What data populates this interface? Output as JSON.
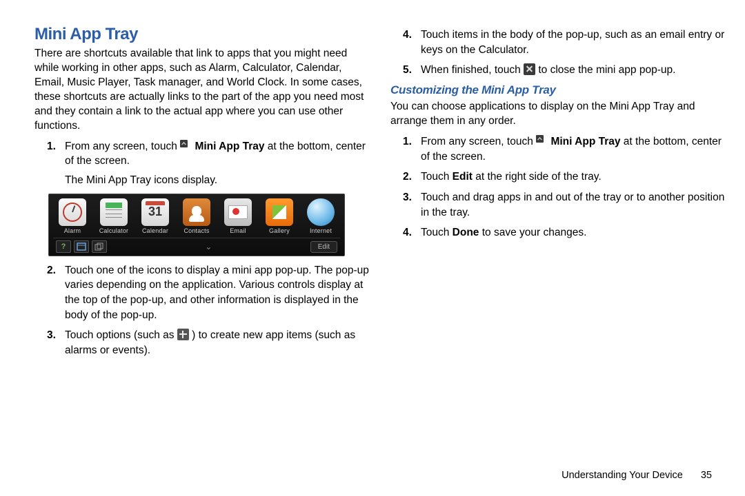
{
  "headings": {
    "section": "Mini App Tray",
    "subsection": "Customizing the Mini App Tray"
  },
  "left": {
    "intro": "There are shortcuts available that link to apps that you might need while working in other apps, such as Alarm, Calculator, Calendar, Email, Music Player, Task manager, and World Clock. In some cases, these shortcuts are actually links to the part of the app you need most and they contain a link to the actual app where you can use other functions.",
    "step1_a": "From any screen, touch ",
    "step1_bold": " Mini App Tray",
    "step1_b": " at the bottom, center of the screen.",
    "step1_after": "The Mini App Tray icons display.",
    "step2": "Touch one of the icons to display a mini app pop-up. The pop-up varies depending on the application. Various controls display at the top of the pop-up, and other information is displayed in the body of the pop-up.",
    "step3_a": "Touch options (such as ",
    "step3_b": ") to create new app items (such as alarms or events)."
  },
  "right": {
    "step4": "Touch items in the body of the pop-up, such as an email entry or keys on the Calculator.",
    "step5_a": "When finished, touch ",
    "step5_b": " to close the mini app pop-up.",
    "intro": "You can choose applications to display on the Mini App Tray and arrange them in any order.",
    "r1_a": "From any screen, touch ",
    "r1_bold": " Mini App Tray",
    "r1_b": " at the bottom, center of the screen.",
    "r2_a": "Touch ",
    "r2_bold": "Edit",
    "r2_b": " at the right side of the tray.",
    "r3": "Touch and drag apps in and out of the tray or to another position in the tray.",
    "r4_a": "Touch ",
    "r4_bold": "Done",
    "r4_b": " to save your changes."
  },
  "tray": {
    "apps": [
      "Alarm",
      "Calculator",
      "Calendar",
      "Contacts",
      "Email",
      "Gallery",
      "Internet"
    ],
    "calendar_day": "31",
    "edit": "Edit",
    "help": "?",
    "chevron": "⌄"
  },
  "footer": {
    "chapter": "Understanding Your Device",
    "page": "35"
  },
  "nums": {
    "n1": "1.",
    "n2": "2.",
    "n3": "3.",
    "n4": "4.",
    "n5": "5."
  }
}
